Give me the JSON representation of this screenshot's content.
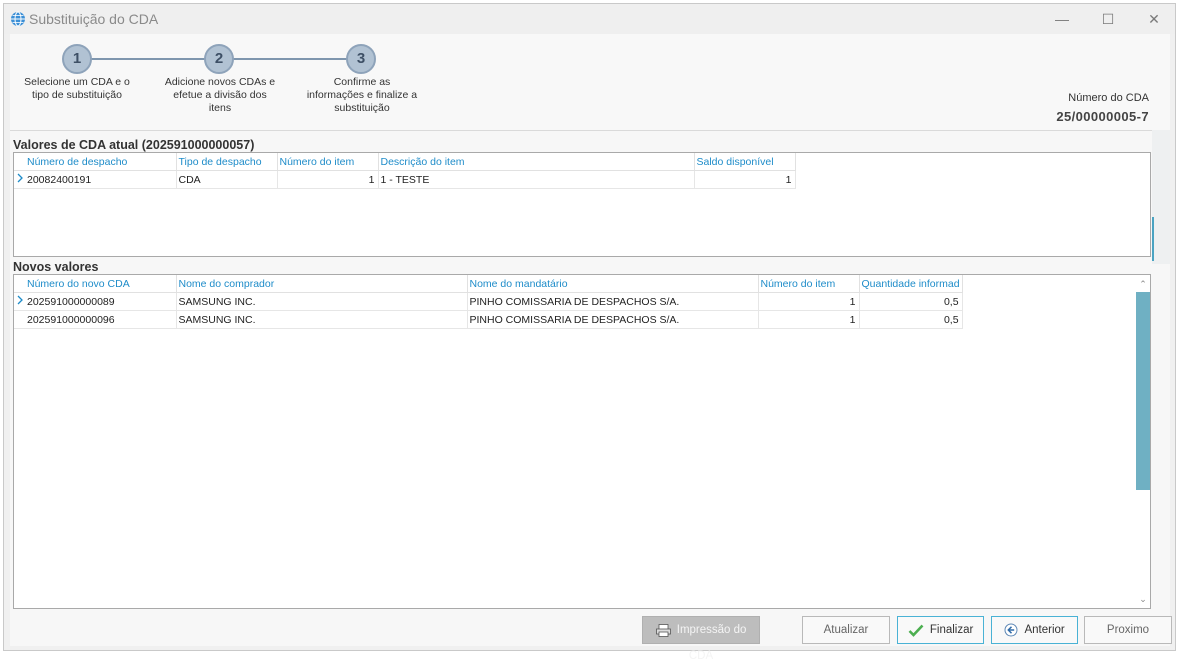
{
  "window": {
    "title": "Substituição do CDA",
    "controls": {
      "minimize": "—",
      "maximize": "☐",
      "close": "✕"
    }
  },
  "wizard": {
    "steps": [
      {
        "number": "1",
        "label_lines": [
          "Selecione um CDA e o",
          "tipo de substituição"
        ]
      },
      {
        "number": "2",
        "label_lines": [
          "Adicione novos CDAs e",
          "efetue a divisão dos",
          "itens"
        ]
      },
      {
        "number": "3",
        "label_lines": [
          "Confirme as",
          "informações e finalize a",
          "substituição"
        ]
      }
    ],
    "cda_number_label": "Número do CDA",
    "cda_number_value": "25/00000005-7"
  },
  "current_values": {
    "title": "Valores de CDA atual (202591000000057)",
    "columns": [
      "Número de despacho",
      "Tipo de despacho",
      "Número do item",
      "Descrição do item",
      "Saldo disponível"
    ],
    "rows": [
      {
        "despacho": "20082400191",
        "tipo": "CDA",
        "numero_item": "1",
        "descricao": "1 - TESTE",
        "saldo": "1"
      }
    ]
  },
  "new_values": {
    "title": "Novos valores",
    "columns": [
      "Número do novo CDA",
      "Nome do comprador",
      "Nome do mandatário",
      "Número do item",
      "Quantidade informad"
    ],
    "rows": [
      {
        "numero_cda": "202591000000089",
        "comprador": "SAMSUNG INC.",
        "mandatario": "PINHO COMISSARIA DE DESPACHOS S/A.",
        "numero_item": "1",
        "quantidade": "0,5"
      },
      {
        "numero_cda": "202591000000096",
        "comprador": "SAMSUNG INC.",
        "mandatario": "PINHO COMISSARIA DE DESPACHOS S/A.",
        "numero_item": "1",
        "quantidade": "0,5"
      }
    ]
  },
  "buttons": {
    "print": "Impressão do CDA",
    "refresh": "Atualizar",
    "finish": "Finalizar",
    "previous": "Anterior",
    "next": "Proximo"
  },
  "icons": {
    "title": "globe-icon",
    "print": "printer-icon",
    "finish": "checkmark-icon",
    "previous": "back-arrow-icon",
    "row_indicator": "chevron-right-icon"
  },
  "colors": {
    "accent": "#1e8cc9",
    "step_circle": "#b1c2d3",
    "scroll_thumb": "#6fb0c3",
    "checkmark": "#4caf50"
  }
}
